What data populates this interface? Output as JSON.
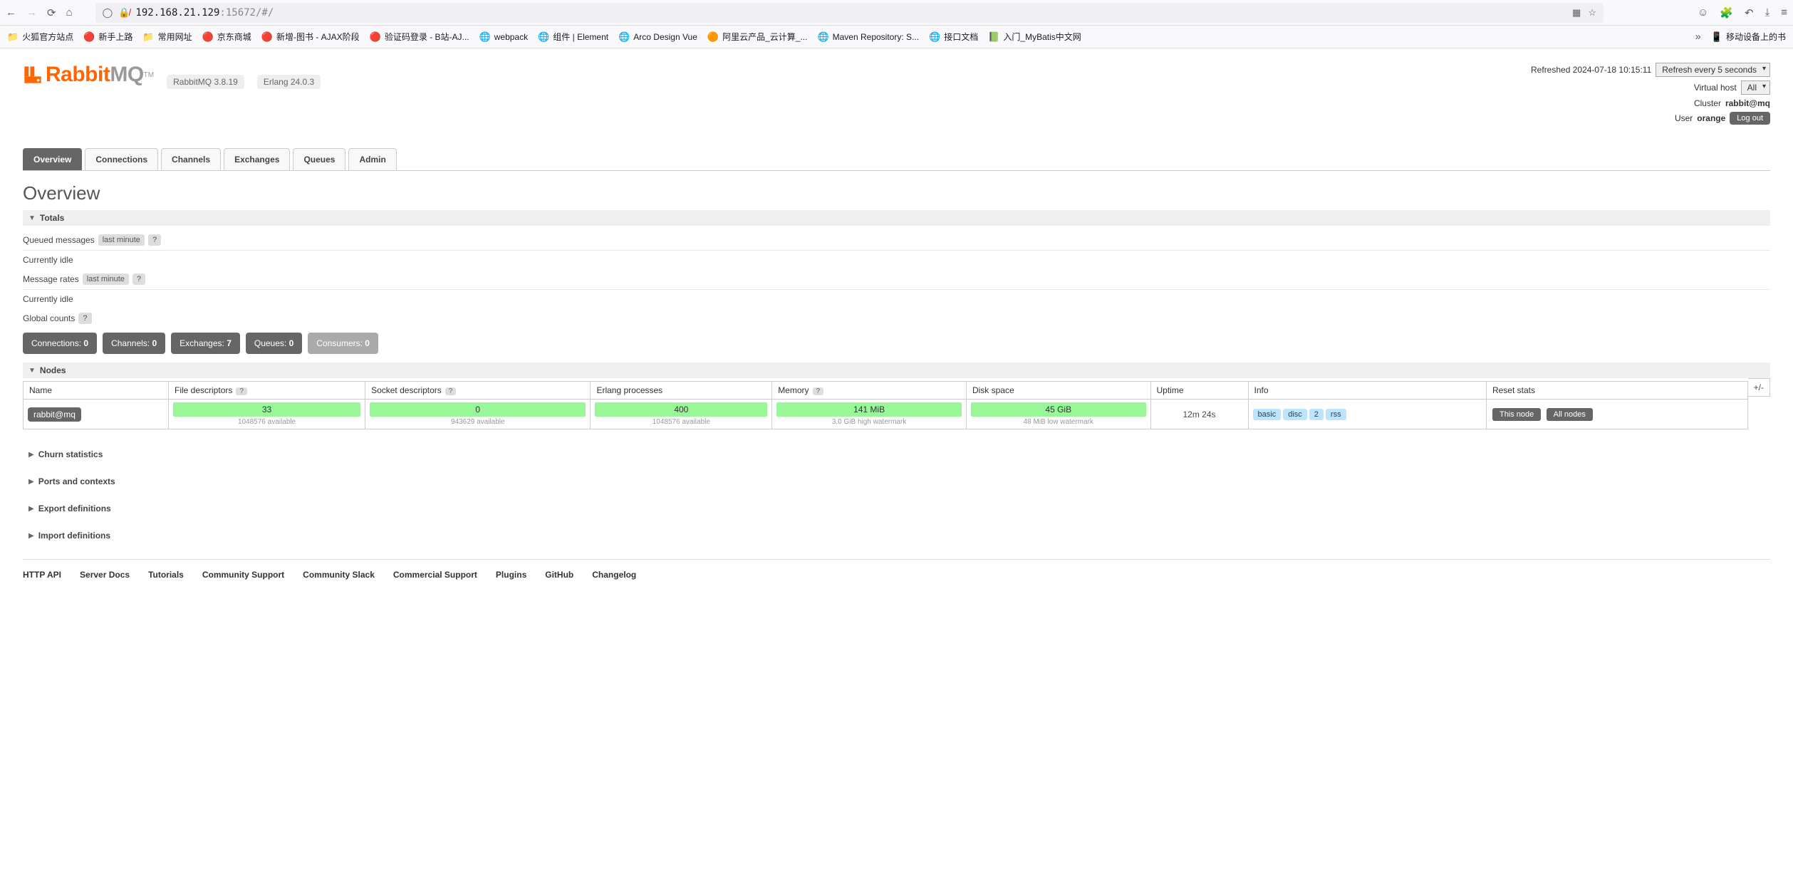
{
  "browser": {
    "url_host": "192.168.21.129",
    "url_rest": ":15672/#/"
  },
  "bookmarks": [
    {
      "icon": "folder",
      "label": "火狐官方站点"
    },
    {
      "icon": "red",
      "label": "新手上路"
    },
    {
      "icon": "folder",
      "label": "常用网址"
    },
    {
      "icon": "red",
      "label": "京东商城"
    },
    {
      "icon": "red",
      "label": "新增-图书 - AJAX阶段"
    },
    {
      "icon": "red",
      "label": "验证码登录 - B站-AJ..."
    },
    {
      "icon": "blue",
      "label": "webpack"
    },
    {
      "icon": "blue",
      "label": "组件 | Element"
    },
    {
      "icon": "blue",
      "label": "Arco Design Vue"
    },
    {
      "icon": "orange",
      "label": "阿里云产品_云计算_..."
    },
    {
      "icon": "blue",
      "label": "Maven Repository: S..."
    },
    {
      "icon": "blue",
      "label": "接口文档"
    },
    {
      "icon": "green",
      "label": "入门_MyBatis中文网"
    }
  ],
  "bookmark_right": {
    "label": "移动设备上的书"
  },
  "versions": {
    "rabbitmq": "RabbitMQ 3.8.19",
    "erlang": "Erlang 24.0.3"
  },
  "top_right": {
    "refreshed": "Refreshed 2024-07-18 10:15:11",
    "refresh_interval": "Refresh every 5 seconds",
    "virtual_host_label": "Virtual host",
    "virtual_host_value": "All",
    "cluster_label": "Cluster",
    "cluster_value": "rabbit@mq",
    "user_label": "User",
    "user_value": "orange",
    "logout": "Log out"
  },
  "tabs": [
    "Overview",
    "Connections",
    "Channels",
    "Exchanges",
    "Queues",
    "Admin"
  ],
  "page_title": "Overview",
  "sections": {
    "totals": "Totals",
    "nodes": "Nodes",
    "churn": "Churn statistics",
    "ports": "Ports and contexts",
    "export": "Export definitions",
    "import": "Import definitions"
  },
  "totals": {
    "queued_label": "Queued messages",
    "last_minute": "last minute",
    "help": "?",
    "idle": "Currently idle",
    "msg_rates": "Message rates",
    "global_counts": "Global counts"
  },
  "counts": [
    {
      "label": "Connections:",
      "value": "0"
    },
    {
      "label": "Channels:",
      "value": "0"
    },
    {
      "label": "Exchanges:",
      "value": "7"
    },
    {
      "label": "Queues:",
      "value": "0"
    },
    {
      "label": "Consumers:",
      "value": "0",
      "muted": true
    }
  ],
  "nodes_headers": {
    "name": "Name",
    "fd": "File descriptors",
    "sd": "Socket descriptors",
    "ep": "Erlang processes",
    "mem": "Memory",
    "disk": "Disk space",
    "uptime": "Uptime",
    "info": "Info",
    "reset": "Reset stats",
    "plusminus": "+/-"
  },
  "node_row": {
    "name": "rabbit@mq",
    "fd": "33",
    "fd_sub": "1048576 available",
    "sd": "0",
    "sd_sub": "943629 available",
    "ep": "400",
    "ep_sub": "1048576 available",
    "mem": "141 MiB",
    "mem_sub": "3.0 GiB high watermark",
    "disk": "45 GiB",
    "disk_sub": "48 MiB low watermark",
    "uptime": "12m 24s",
    "info_tags": [
      "basic",
      "disc",
      "2",
      "rss"
    ],
    "reset_this": "This node",
    "reset_all": "All nodes"
  },
  "footer": [
    "HTTP API",
    "Server Docs",
    "Tutorials",
    "Community Support",
    "Community Slack",
    "Commercial Support",
    "Plugins",
    "GitHub",
    "Changelog"
  ]
}
